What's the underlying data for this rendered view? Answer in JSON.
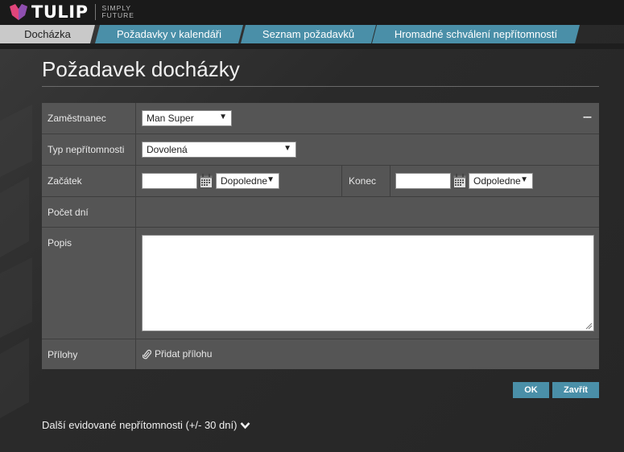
{
  "brand": {
    "name": "TULIP",
    "tagline_1": "SIMPLY",
    "tagline_2": "FUTURE"
  },
  "tabs": [
    {
      "label": "Docházka",
      "active": true
    },
    {
      "label": "Požadavky v kalendáři",
      "active": false
    },
    {
      "label": "Seznam požadavků",
      "active": false
    },
    {
      "label": "Hromadné schválení nepřítomností",
      "active": false
    }
  ],
  "page_title": "Požadavek docházky",
  "form": {
    "employee_label": "Zaměstnanec",
    "employee_value": "Man Super",
    "more_label": "---",
    "absence_type_label": "Typ nepřítomnosti",
    "absence_type_value": "Dovolená",
    "start_label": "Začátek",
    "start_date_value": "",
    "start_part_value": "Dopoledne",
    "end_label": "Konec",
    "end_date_value": "",
    "end_part_value": "Odpoledne",
    "days_label": "Počet dní",
    "days_value": "",
    "description_label": "Popis",
    "description_value": "",
    "attachments_label": "Přílohy",
    "add_attachment_label": "Přidat přílohu"
  },
  "buttons": {
    "ok": "OK",
    "close": "Zavřít"
  },
  "footer": {
    "other_absences": "Další evidované nepřítomnosti (+/- 30 dní)"
  },
  "colors": {
    "accent": "#4a8fa8",
    "active_tab": "#c9c9c9",
    "form_bg": "#555555",
    "page_bg": "#2b2b2b",
    "logo_pink": "#e0457b",
    "logo_purple": "#8e4fb0"
  }
}
